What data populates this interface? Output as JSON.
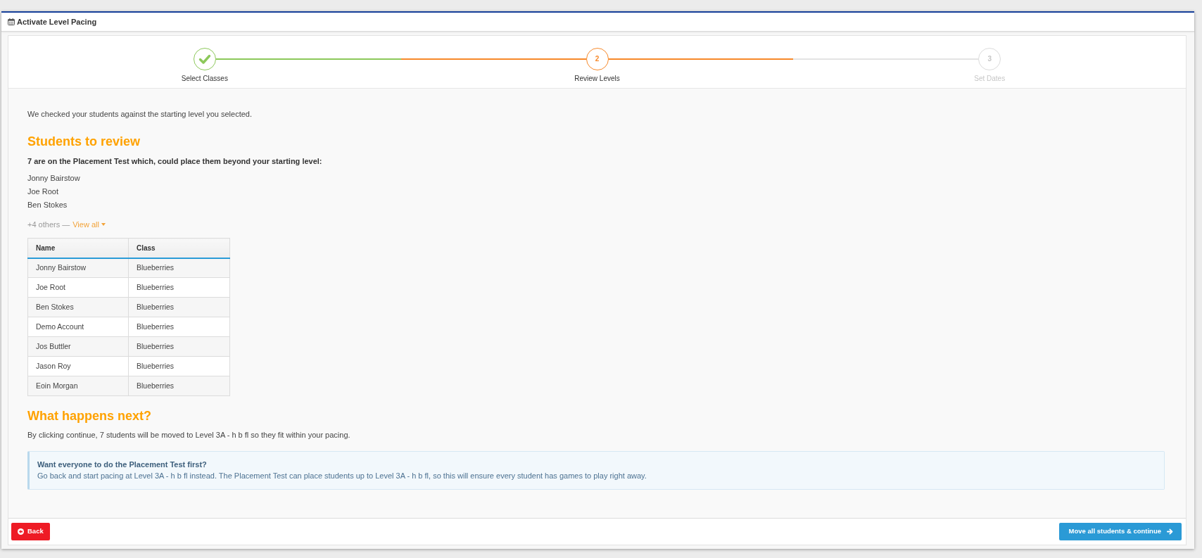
{
  "window": {
    "title": "Activate Level Pacing"
  },
  "steps": [
    {
      "label": "Select Classes",
      "completed": true,
      "current": false
    },
    {
      "number": "2",
      "label": "Review Levels",
      "completed": false,
      "current": true
    },
    {
      "number": "3",
      "label": "Set Dates",
      "completed": false,
      "current": false
    }
  ],
  "intro": "We checked your students against the starting level you selected.",
  "review": {
    "heading": "Students to review",
    "summary": "7 are on the Placement Test which, could place them beyond your starting level:",
    "names": [
      "Jonny Bairstow",
      "Joe Root",
      "Ben Stokes"
    ],
    "others": "+4 others —",
    "view_all": "View all"
  },
  "table": {
    "columns": [
      "Name",
      "Class"
    ],
    "rows": [
      [
        "Jonny Bairstow",
        "Blueberries"
      ],
      [
        "Joe Root",
        "Blueberries"
      ],
      [
        "Ben Stokes",
        "Blueberries"
      ],
      [
        "Demo Account",
        "Blueberries"
      ],
      [
        "Jos Buttler",
        "Blueberries"
      ],
      [
        "Jason Roy",
        "Blueberries"
      ],
      [
        "Eoin Morgan",
        "Blueberries"
      ]
    ]
  },
  "next": {
    "heading": "What happens next?",
    "text": "By clicking continue, 7 students will be moved to Level 3A - h b fl so they fit within your pacing."
  },
  "callout": {
    "title": "Want everyone to do the Placement Test first?",
    "text": "Go back and start pacing at Level 3A - h b fl instead. The Placement Test can place students up to Level 3A - h b fl, so this will ensure every student has games to play right away."
  },
  "footer": {
    "back": "Back",
    "continue": "Move all students & continue"
  }
}
